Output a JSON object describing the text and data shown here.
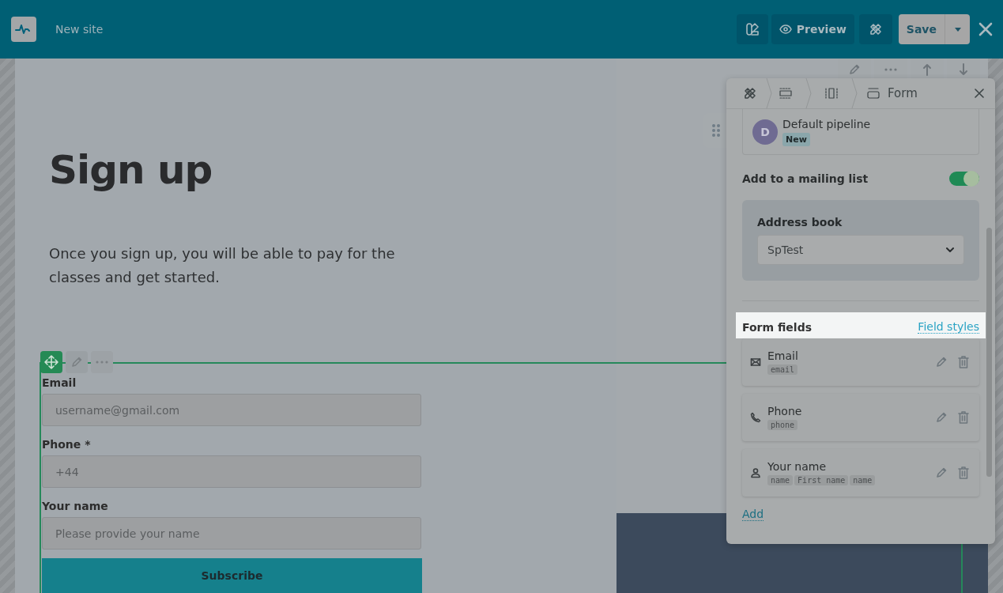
{
  "topbar": {
    "site_name": "New site",
    "preview_label": "Preview",
    "save_label": "Save"
  },
  "page": {
    "heading": "Sign up",
    "intro": "Once you sign up, you will be able to pay for the classes and get started.",
    "form": {
      "fields": [
        {
          "label": "Email",
          "placeholder": "username@gmail.com"
        },
        {
          "label": "Phone *",
          "placeholder": "+44"
        },
        {
          "label": "Your name",
          "placeholder": "Please provide your name"
        }
      ],
      "submit": "Subscribe"
    }
  },
  "panel": {
    "title": "Form",
    "pipeline": {
      "avatar": "D",
      "name": "Default pipeline",
      "badge": "New"
    },
    "mailing": {
      "label": "Add to a mailing list",
      "on": true
    },
    "address_book": {
      "label": "Address book",
      "value": "SpTest"
    },
    "fields_header": {
      "title": "Form fields",
      "link": "Field styles"
    },
    "fields": [
      {
        "kind": "email",
        "label": "Email",
        "tags": [
          "email"
        ]
      },
      {
        "kind": "phone",
        "label": "Phone",
        "tags": [
          "phone"
        ]
      },
      {
        "kind": "person",
        "label": "Your name",
        "tags": [
          "name",
          "First name",
          "name"
        ]
      }
    ],
    "add": "Add"
  }
}
